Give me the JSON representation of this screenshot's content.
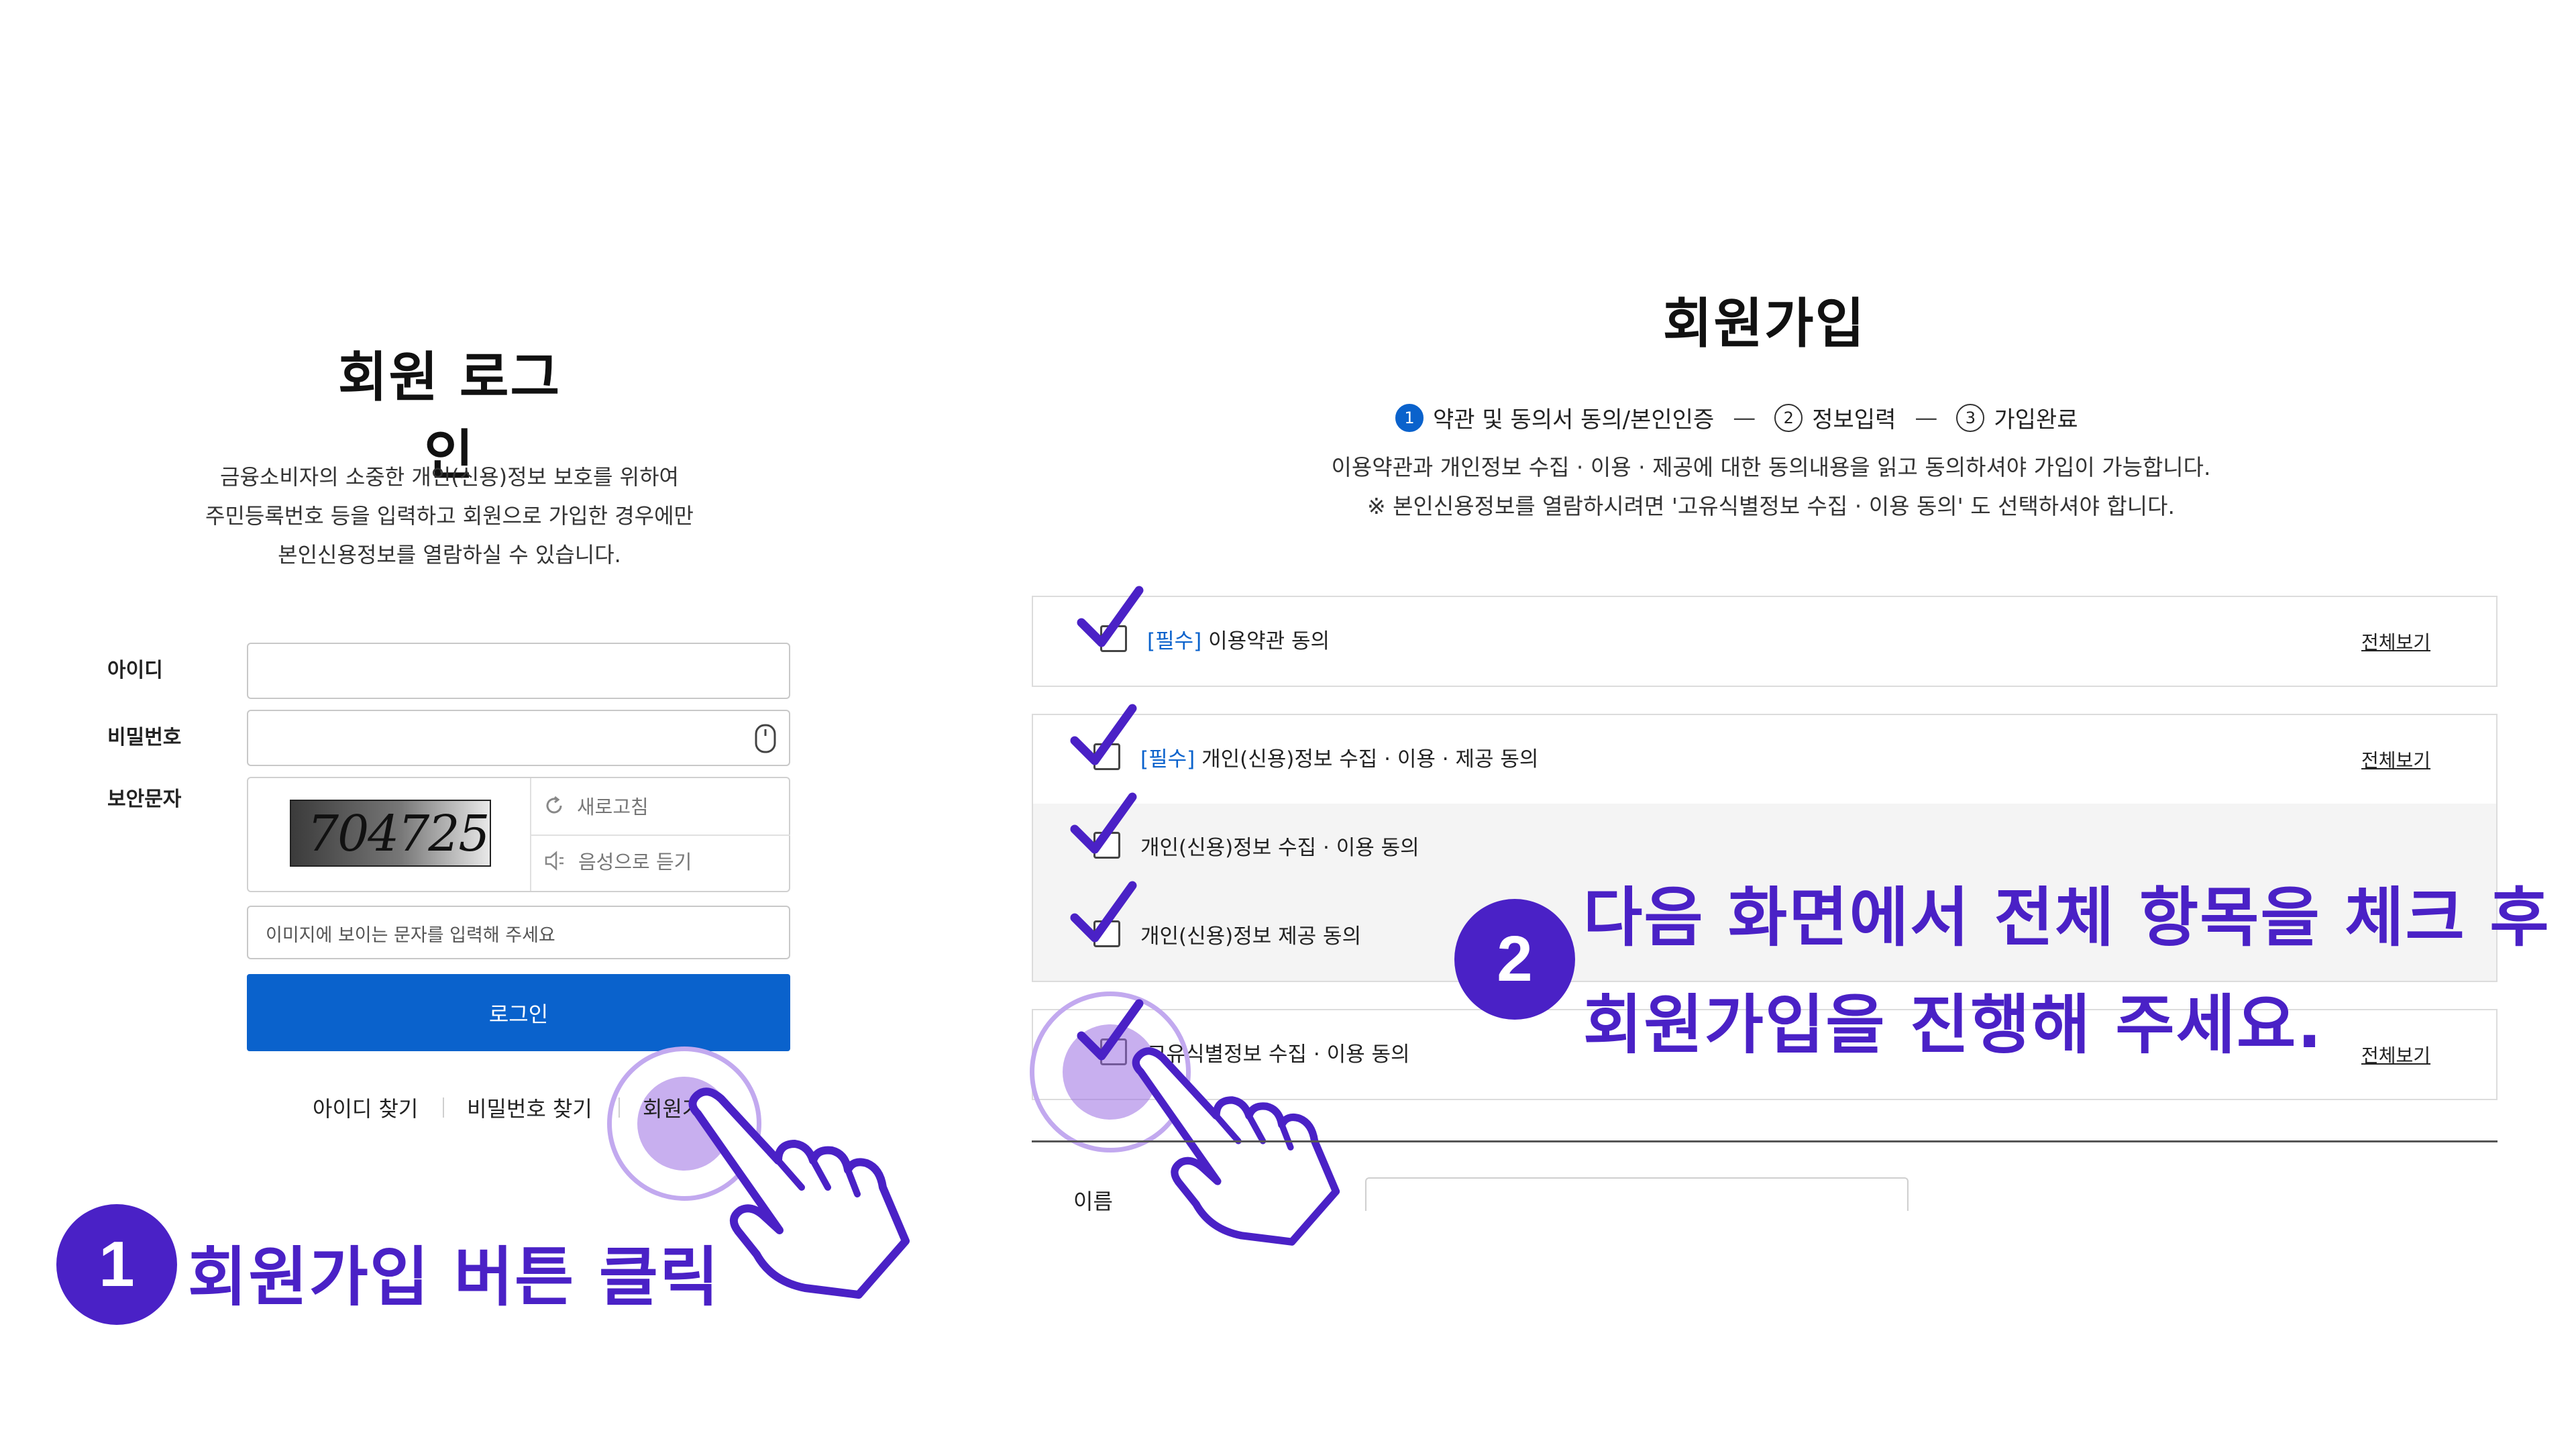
{
  "login": {
    "title": "회원 로그인",
    "description": [
      "금융소비자의 소중한 개인(신용)정보 보호를 위하여",
      "주민등록번호 등을 입력하고 회원으로 가입한 경우에만",
      "본인신용정보를 열람하실 수 있습니다."
    ],
    "id_label": "아이디",
    "password_label": "비밀번호",
    "captcha_label": "보안문자",
    "captcha_code": "704725",
    "refresh_label": "새로고침",
    "audio_label": "음성으로 듣기",
    "captcha_placeholder": "이미지에 보이는 문자를 입력해 주세요",
    "login_button": "로그인",
    "links": [
      "아이디 찾기",
      "비밀번호 찾기",
      "회원가입"
    ]
  },
  "step1": {
    "badge": "1",
    "caption": "회원가입 버튼 클릭"
  },
  "step2": {
    "badge": "2",
    "caption_lines": [
      "다음 화면에서 전체 항목을 체크 후",
      "회원가입을 진행해 주세요."
    ]
  },
  "signup": {
    "title": "회원가입",
    "steps": [
      {
        "num": "1",
        "label": "약관 및 동의서 동의/본인인증",
        "active": true
      },
      {
        "num": "2",
        "label": "정보입력",
        "active": false
      },
      {
        "num": "3",
        "label": "가입완료",
        "active": false
      }
    ],
    "step_separator": "—",
    "notice": [
      "이용약관과 개인정보 수집 · 이용 · 제공에 대한 동의내용을 읽고 동의하셔야 가입이 가능합니다.",
      "※ 본인신용정보를 열람하시려면 '고유식별정보 수집 · 이용 동의' 도 선택하셔야 합니다."
    ],
    "required_tag": "[필수]",
    "agreements": {
      "terms": "이용약관 동의",
      "personal": "개인(신용)정보 수집 · 이용 · 제공 동의",
      "personal_collect": "개인(신용)정보 수집 · 이용 동의",
      "personal_provide": "개인(신용)정보 제공 동의",
      "unique_id": "고유식별정보 수집 · 이용 동의"
    },
    "view_all": "전체보기",
    "name_label": "이름"
  },
  "colors": {
    "accent_purple": "#4a21c6",
    "primary_blue": "#0a62cc",
    "highlight": "#c2a9ef"
  }
}
